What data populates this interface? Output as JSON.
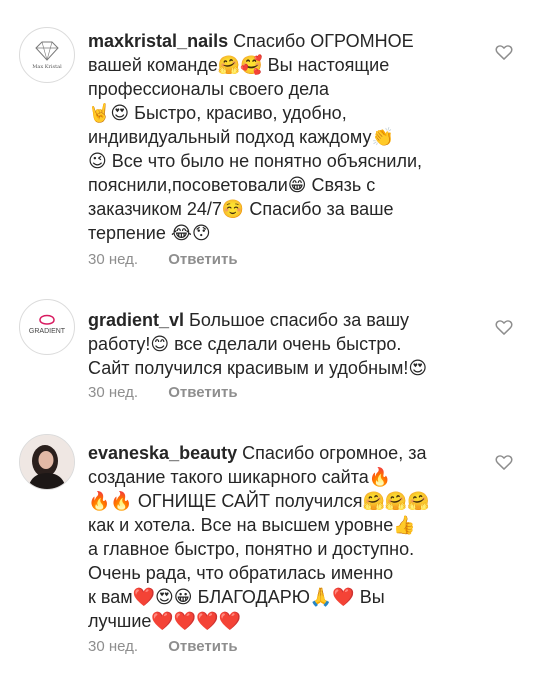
{
  "comments": [
    {
      "username": "maxkristal_nails",
      "lines": [
        "Спасибо ОГРОМНОЕ",
        "вашей команде🤗🥰 Вы настоящие",
        "профессионалы своего дела",
        "🤘😍 Быстро, красиво, удобно,",
        "индивидуальный подход каждому👏",
        "😉 Все что было не понятно объяснили,",
        "пояснили,посоветовали😁 Связь с",
        "заказчиком 24/7☺️ Спасибо за ваше",
        "терпение 😂😯"
      ],
      "time": "30 нед.",
      "reply": "Ответить",
      "avatar_text": "Max Kristal"
    },
    {
      "username": "gradient_vl",
      "lines": [
        "Большое спасибо за вашу",
        "работу!😊 все сделали очень быстро.",
        "Сайт получился красивым и удобным!😍"
      ],
      "time": "30 нед.",
      "reply": "Ответить",
      "avatar_text": "GRADIENT"
    },
    {
      "username": "evaneska_beauty",
      "lines": [
        "Спасибо огромное, за",
        "создание такого шикарного сайта🔥",
        "🔥🔥 ОГНИЩЕ САЙТ получился🤗🤗🤗",
        "как и хотела. Все на высшем уровне👍",
        "а главное быстро, понятно и доступно.",
        "Очень рада, что обратилась именно",
        "к вам❤️😍😀 БЛАГОДАРЮ🙏❤️ Вы",
        "лучшие❤️❤️❤️❤️"
      ],
      "time": "30 нед.",
      "reply": "Ответить"
    }
  ],
  "colors": {
    "text": "#262626",
    "secondary": "#8e8e8e",
    "heart_outline": "#8e8e8e",
    "gradient_pink": "#d81b60"
  },
  "icons": {
    "like": "heart-outline-icon"
  }
}
